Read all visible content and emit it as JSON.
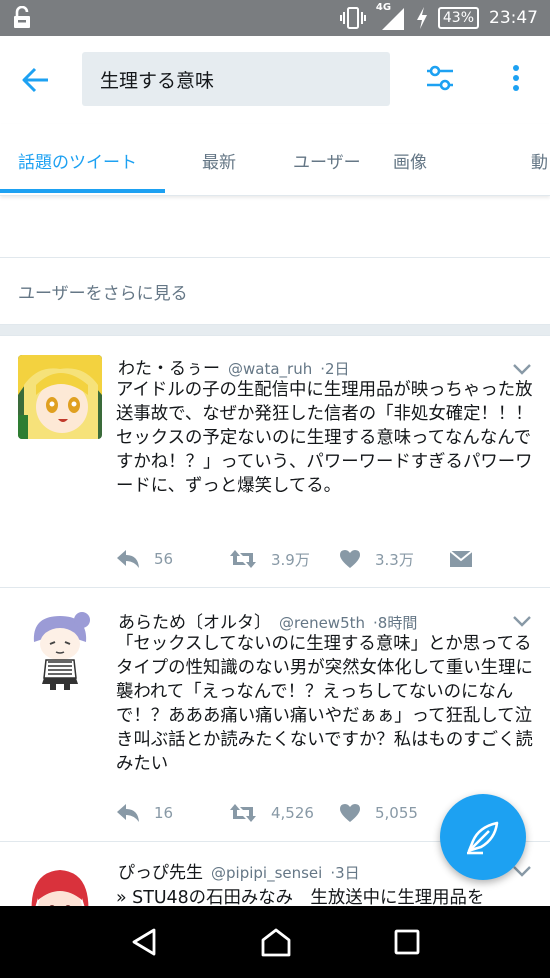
{
  "status_bar": {
    "network": "4G",
    "battery": "43%",
    "time": "23:47",
    "icons": [
      "lock-icon",
      "vibrate-icon",
      "signal-icon",
      "charging-icon"
    ]
  },
  "header": {
    "search_value": "生理する意味",
    "icons": [
      "back-arrow-icon",
      "filter-icon",
      "more-vertical-icon"
    ]
  },
  "tabs": [
    {
      "label": "話題のツイート",
      "active": true
    },
    {
      "label": "最新"
    },
    {
      "label": "ユーザー"
    },
    {
      "label": "画像"
    },
    {
      "label": "動"
    }
  ],
  "see_more_users": "ユーザーをさらに見る",
  "tweets": [
    {
      "name": "わた・るぅー",
      "handle": "@wata_ruh",
      "time": "2日",
      "text": "アイドルの子の生配信中に生理用品が映っちゃった放送事故で、なぜか発狂した信者の「非処女確定！！！セックスの予定ないのに生理する意味ってなんなんですかね！？」っていう、パワーワードすぎるパワーワードに、ずっと爆笑してる。",
      "replies": "56",
      "retweets": "3.9万",
      "likes": "3.3万"
    },
    {
      "name": "あらため〔オルタ〕",
      "handle": "@renew5th",
      "time": "8時間",
      "text": "「セックスしてないのに生理する意味」とか思ってるタイプの性知識のない男が突然女体化して重い生理に襲われて「えっなんで！？えっちしてないのになんで！？あああ痛い痛い痛いやだぁぁ」って狂乱して泣き叫ぶ話とか読みたくないですか？私はものすごく読みたい",
      "replies": "16",
      "retweets": "4,526",
      "likes": "5,055"
    },
    {
      "name": "ぴっぴ先生",
      "handle": "@pipipi_sensei",
      "time": "3日",
      "text": "» STU48の石田みなみ　生放送中に生理用品を"
    }
  ],
  "colors": {
    "accent": "#1da1f2",
    "status_bar": "#7a7d80",
    "secondary_text": "#657786"
  }
}
